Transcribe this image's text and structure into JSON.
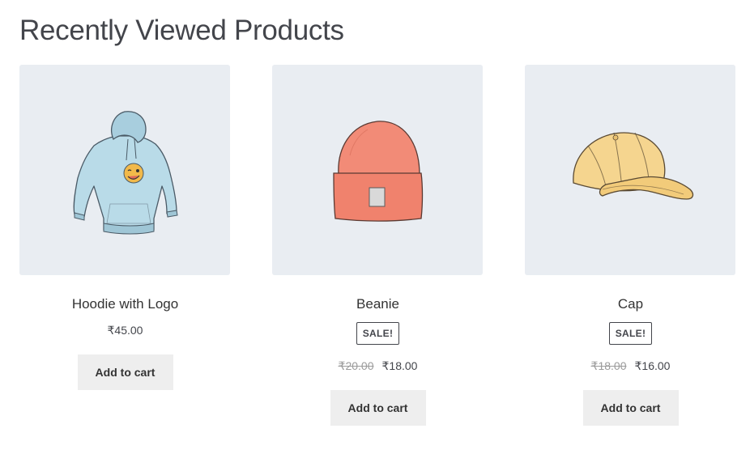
{
  "section": {
    "title": "Recently Viewed Products"
  },
  "products": [
    {
      "name": "Hoodie with Logo",
      "image_icon": "hoodie-icon",
      "on_sale": false,
      "price": "₹45.00",
      "button_label": "Add to cart"
    },
    {
      "name": "Beanie",
      "image_icon": "beanie-icon",
      "on_sale": true,
      "sale_badge": "SALE!",
      "regular_price": "₹20.00",
      "price": "₹18.00",
      "button_label": "Add to cart"
    },
    {
      "name": "Cap",
      "image_icon": "cap-icon",
      "on_sale": true,
      "sale_badge": "SALE!",
      "regular_price": "₹18.00",
      "price": "₹16.00",
      "button_label": "Add to cart"
    }
  ],
  "colors": {
    "image_background": "#e9edf2",
    "button_background": "#eeeeee",
    "hoodie": "#b9dbe8",
    "beanie": "#f28b77",
    "cap": "#f5d58f"
  }
}
